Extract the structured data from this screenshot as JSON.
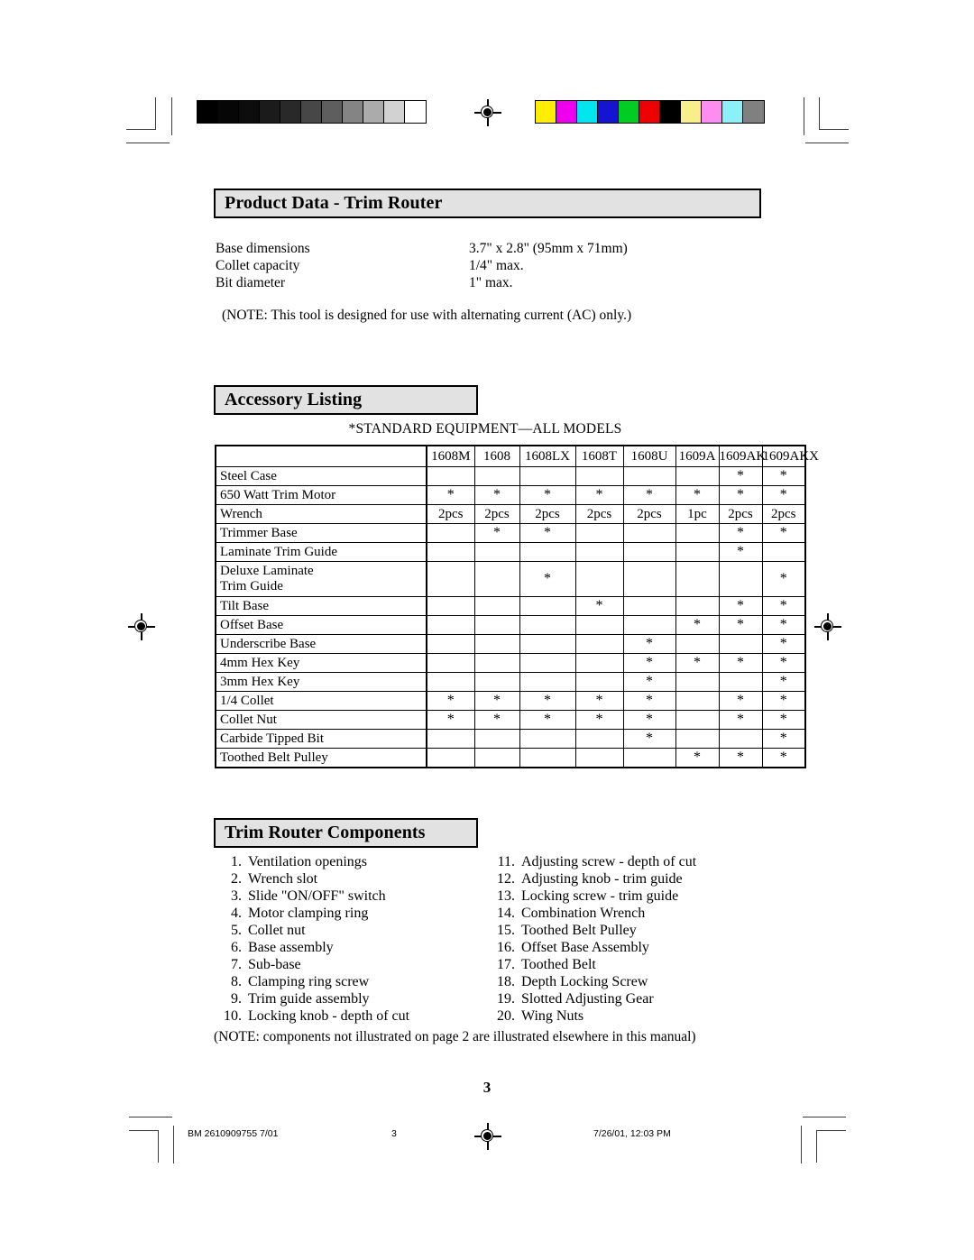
{
  "document": {
    "page_number": "3"
  },
  "calibration": {
    "grayscale_label": "grayscale-ramp",
    "grayscale_patches": [
      "#000000",
      "#060606",
      "#0d0d0d",
      "#1b1b1b",
      "#292929",
      "#474747",
      "#5e5e5e",
      "#848484",
      "#ababab",
      "#d2d2d2",
      "#ffffff"
    ],
    "color_label": "color-bar",
    "color_patches": [
      "#ffee00",
      "#ee00ee",
      "#00e5ee",
      "#1414d2",
      "#00cc22",
      "#ee0000",
      "#000000",
      "#f8ef8c",
      "#ff8cf0",
      "#8cf0f8",
      "#808080"
    ]
  },
  "product_data": {
    "heading": "Product Data - Trim Router",
    "specs": [
      {
        "name": "Base dimensions",
        "value": "3.7\" x 2.8\" (95mm x 71mm)"
      },
      {
        "name": "Collet capacity",
        "value": "1/4\" max."
      },
      {
        "name": "Bit diameter",
        "value": "1\" max."
      }
    ],
    "note": "(NOTE: This tool is designed for use with alternating current (AC) only.)"
  },
  "accessory_listing": {
    "heading": "Accessory Listing",
    "standard_equipment_caption": "*STANDARD EQUIPMENT—ALL MODELS",
    "columns": [
      "1608M",
      "1608",
      "1608LX",
      "1608T",
      "1608U",
      "1609A",
      "1609AK",
      "1609AKX"
    ],
    "rows": [
      {
        "label": "Steel Case",
        "cells": [
          "",
          "",
          "",
          "",
          "",
          "",
          "*",
          "*"
        ]
      },
      {
        "label": "650 Watt Trim Motor",
        "cells": [
          "*",
          "*",
          "*",
          "*",
          "*",
          "*",
          "*",
          "*"
        ]
      },
      {
        "label": "Wrench",
        "cells": [
          "2pcs",
          "2pcs",
          "2pcs",
          "2pcs",
          "2pcs",
          "1pc",
          "2pcs",
          "2pcs"
        ]
      },
      {
        "label": "Trimmer Base",
        "cells": [
          "",
          "*",
          "*",
          "",
          "",
          "",
          "*",
          "*"
        ]
      },
      {
        "label": "Laminate Trim Guide",
        "cells": [
          "",
          "",
          "",
          "",
          "",
          "",
          "*",
          ""
        ]
      },
      {
        "label": "Deluxe Laminate\nTrim Guide",
        "cells": [
          "",
          "",
          "*",
          "",
          "",
          "",
          "",
          "*"
        ]
      },
      {
        "label": "Tilt Base",
        "cells": [
          "",
          "",
          "",
          "*",
          "",
          "",
          "*",
          "*"
        ]
      },
      {
        "label": "Offset Base",
        "cells": [
          "",
          "",
          "",
          "",
          "",
          "*",
          "*",
          "*"
        ]
      },
      {
        "label": "Underscribe Base",
        "cells": [
          "",
          "",
          "",
          "",
          "*",
          "",
          "",
          "*"
        ]
      },
      {
        "label": "4mm Hex Key",
        "cells": [
          "",
          "",
          "",
          "",
          "*",
          "*",
          "*",
          "*"
        ]
      },
      {
        "label": "3mm Hex Key",
        "cells": [
          "",
          "",
          "",
          "",
          "*",
          "",
          "",
          "*"
        ]
      },
      {
        "label": "1/4 Collet",
        "cells": [
          "*",
          "*",
          "*",
          "*",
          "*",
          "",
          "*",
          "*"
        ]
      },
      {
        "label": "Collet Nut",
        "cells": [
          "*",
          "*",
          "*",
          "*",
          "*",
          "",
          "*",
          "*"
        ]
      },
      {
        "label": "Carbide Tipped Bit",
        "cells": [
          "",
          "",
          "",
          "",
          "*",
          "",
          "",
          "*"
        ]
      },
      {
        "label": "Toothed Belt Pulley",
        "cells": [
          "",
          "",
          "",
          "",
          "",
          "*",
          "*",
          "*"
        ]
      }
    ]
  },
  "components": {
    "heading": "Trim Router Components",
    "left_column": [
      {
        "num": "1.",
        "text": "Ventilation openings"
      },
      {
        "num": "2.",
        "text": "Wrench slot"
      },
      {
        "num": "3.",
        "text": "Slide \"ON/OFF\" switch"
      },
      {
        "num": "4.",
        "text": "Motor clamping ring"
      },
      {
        "num": "5.",
        "text": "Collet nut"
      },
      {
        "num": "6.",
        "text": "Base assembly"
      },
      {
        "num": "7.",
        "text": "Sub-base"
      },
      {
        "num": "8.",
        "text": "Clamping ring screw"
      },
      {
        "num": "9.",
        "text": "Trim guide assembly"
      },
      {
        "num": "10.",
        "text": "Locking knob - depth of cut"
      }
    ],
    "right_column": [
      {
        "num": "11.",
        "text": "Adjusting screw - depth of cut"
      },
      {
        "num": "12.",
        "text": "Adjusting knob - trim guide"
      },
      {
        "num": "13.",
        "text": "Locking screw - trim guide"
      },
      {
        "num": "14.",
        "text": "Combination Wrench"
      },
      {
        "num": "15.",
        "text": "Toothed Belt Pulley"
      },
      {
        "num": "16.",
        "text": "Offset Base Assembly"
      },
      {
        "num": "17.",
        "text": "Toothed Belt"
      },
      {
        "num": "18.",
        "text": "Depth Locking Screw"
      },
      {
        "num": "19.",
        "text": "Slotted Adjusting Gear"
      },
      {
        "num": "20.",
        "text": "Wing Nuts"
      }
    ],
    "note": "(NOTE: components not illustrated on page 2 are illustrated elsewhere in this manual)"
  },
  "footer": {
    "doc_id": "BM 2610909755 7/01",
    "page": "3",
    "timestamp": "7/26/01, 12:03 PM"
  }
}
